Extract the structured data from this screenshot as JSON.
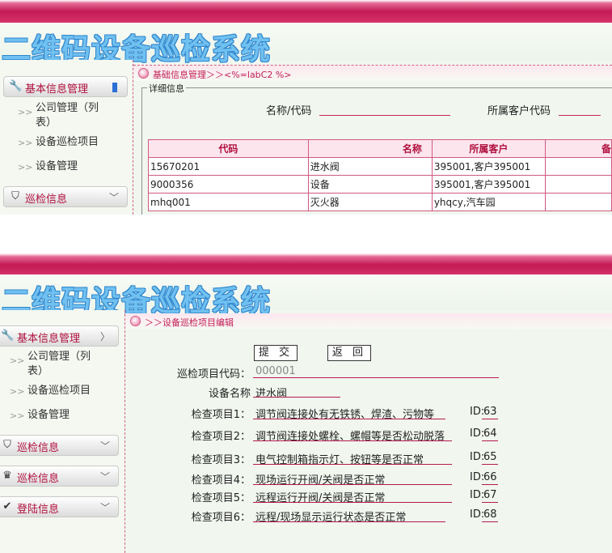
{
  "shot1": {
    "app_title": "二维码设备巡检系统",
    "breadcrumb": "基础信息管理＞＞<%=labC2 %>",
    "sidebar": {
      "menu1": {
        "label": "基本信息管理",
        "icon": "wrench-icon"
      },
      "items": [
        "公司管理（列",
        "表）",
        "设备巡检项目",
        "设备管理"
      ],
      "menu2": {
        "label": "巡检信息",
        "icon": "badge-icon"
      }
    },
    "detail": {
      "legend": "详细信息",
      "name_code_label": "名称/代码",
      "customer_code_label": "所属客户代码"
    },
    "table": {
      "headers": [
        "代码",
        "名称",
        "所属客户",
        "备"
      ],
      "rows": [
        [
          "15670201",
          "进水阀",
          "395001,客户395001",
          ""
        ],
        [
          "9000356",
          "设备",
          "395001,客户395001",
          ""
        ],
        [
          "mhq001",
          "灭火器",
          "yhqcy,汽车园",
          ""
        ]
      ]
    }
  },
  "shot2": {
    "app_title": "二维码设备巡检系统",
    "breadcrumb": "＞＞设备巡检项目编辑",
    "sidebar": {
      "menu1": {
        "label": "基本信息管理",
        "icon": "wrench-icon"
      },
      "items": [
        "公司管理（列",
        "表）",
        "设备巡检项目",
        "设备管理"
      ],
      "menu2": {
        "label": "巡检信息",
        "icon": "badge-icon"
      },
      "menu3": {
        "label": "巡检信息",
        "icon": "crown-icon"
      },
      "menu4": {
        "label": "登陆信息",
        "icon": "check-icon"
      }
    },
    "buttons": {
      "submit": "提 交",
      "back": "返 回"
    },
    "form": {
      "code_label": "巡检项目代码：",
      "code_value": "000001",
      "name_label": "设备名称",
      "name_value": "进水阀",
      "items": [
        {
          "label": "检查项目1：",
          "value": "调节阀连接处有无铁锈、焊渣、污物等",
          "id_label": "ID:",
          "id": "63"
        },
        {
          "label": "检查项目2：",
          "value": "调节阀连接处螺栓、螺帽等是否松动脱落",
          "id_label": "ID:",
          "id": "64"
        },
        {
          "label": "检查项目3：",
          "value": "电气控制箱指示灯、按钮等是否正常",
          "id_label": "ID:",
          "id": "65"
        },
        {
          "label": "检查项目4：",
          "value": "现场运行开阀/关阀是否正常",
          "id_label": "ID:",
          "id": "66"
        },
        {
          "label": "检查项目5：",
          "value": "远程运行开阀/关阀是否正常",
          "id_label": "ID:",
          "id": "67"
        },
        {
          "label": "检查项目6：",
          "value": "远程/现场显示运行状态是否正常",
          "id_label": "ID:",
          "id": "68"
        }
      ]
    }
  }
}
